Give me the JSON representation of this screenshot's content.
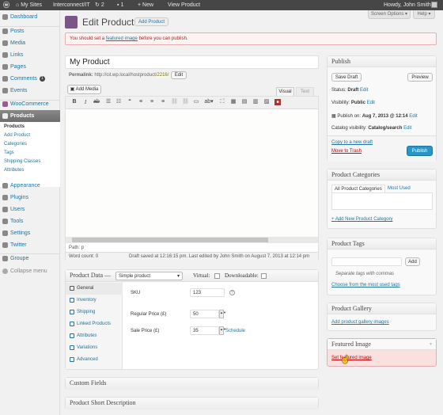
{
  "adminbar": {
    "sites": "My Sites",
    "site": "Interconnect/IT",
    "updates": "2",
    "comments": "1",
    "new": "+ New",
    "view": "View Product",
    "howdy": "Howdy, John Smith"
  },
  "menu": {
    "dashboard": "Dashboard",
    "posts": "Posts",
    "media": "Media",
    "links": "Links",
    "pages": "Pages",
    "comments": "Comments",
    "comments_count": "1",
    "events": "Events",
    "woocommerce": "WooCommerce",
    "products": "Products",
    "appearance": "Appearance",
    "plugins": "Plugins",
    "users": "Users",
    "tools": "Tools",
    "settings": "Settings",
    "twitter": "Twitter",
    "groupe": "Groupe",
    "collapse": "Collapse menu"
  },
  "submenu": [
    "Products",
    "Add Product",
    "Categories",
    "Tags",
    "Shipping Classes",
    "Attributes"
  ],
  "header": {
    "screen_options": "Screen Options ▾",
    "help": "Help ▾",
    "title": "Edit Product",
    "add_new": "Add Product"
  },
  "notice": {
    "before": "You should set a ",
    "link": "featured image",
    "after": " before you can publish."
  },
  "post": {
    "title": "My Product",
    "permalink_label": "Permalink:",
    "permalink_base": "http://cit.wp.local/hostproduct/",
    "permalink_slug": "2216/",
    "edit": "Edit"
  },
  "editor": {
    "add_media": "Add Media",
    "tab_visual": "Visual",
    "tab_text": "Text",
    "path": "Path: p",
    "word_count": "Word count: 0",
    "draft_saved": "Draft saved at 12:16:15 pm. Last edited by John Smith on August 7, 2013 at 12:14 pm"
  },
  "product_data": {
    "label": "Product Data —",
    "type": "Simple product",
    "virtual": "Virtual:",
    "downloadable": "Downloadable:",
    "tabs": [
      "General",
      "Inventory",
      "Shipping",
      "Linked Products",
      "Attributes",
      "Variations",
      "Advanced"
    ],
    "sku_label": "SKU",
    "sku": "123",
    "regular_label": "Regular Price (£)",
    "regular": "50",
    "sale_label": "Sale Price (£)",
    "sale": "35",
    "schedule": "Schedule"
  },
  "custom_fields": "Custom Fields",
  "short_desc": "Product Short Description",
  "publish": {
    "title": "Publish",
    "save_draft": "Save Draft",
    "preview": "Preview",
    "status_label": "Status:",
    "status": "Draft",
    "visibility_label": "Visibility:",
    "visibility": "Public",
    "publish_label": "Publish on:",
    "publish_date": "Aug 7, 2013 @ 12:14",
    "catalog_label": "Catalog visibility:",
    "catalog": "Catalog/search",
    "edit": "Edit",
    "copy": "Copy to a new draft",
    "trash": "Move to Trash",
    "publish_button": "Publish"
  },
  "categories": {
    "title": "Product Categories",
    "tab_all": "All Product Categories",
    "tab_used": "Most Used",
    "add": "+ Add New Product Category"
  },
  "tags": {
    "title": "Product Tags",
    "add": "Add",
    "hint": "Separate tags with commas",
    "choose": "Choose from the most used tags"
  },
  "gallery": {
    "title": "Product Gallery",
    "add": "Add product gallery images"
  },
  "featured": {
    "title": "Featured Image",
    "set": "Set featured image"
  },
  "colors": {
    "adminbar": "#464646",
    "accent": "#21759b",
    "publish": "#2a95c5",
    "notice_border": "#e6aeae",
    "notice_bg": "#fdf3f3",
    "highlight": "#fbe0e0"
  }
}
